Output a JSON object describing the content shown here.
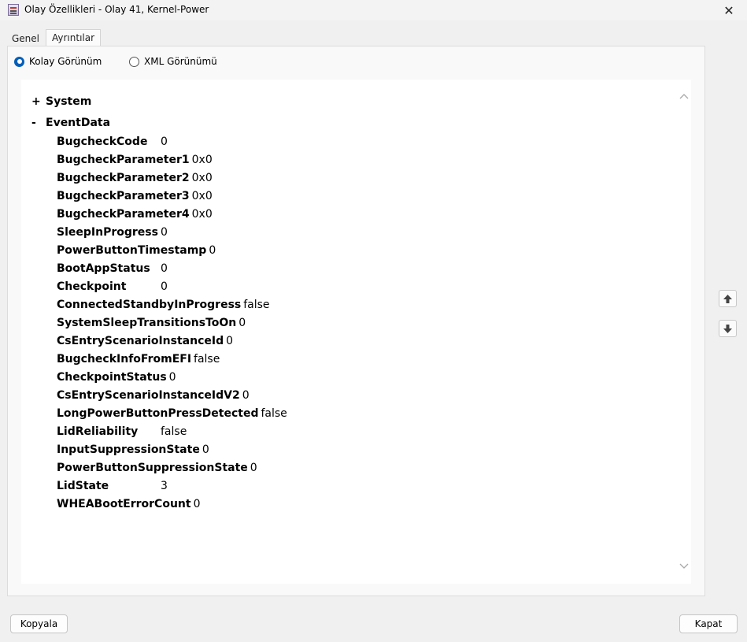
{
  "window": {
    "title": "Olay Özellikleri - Olay 41, Kernel-Power",
    "close_glyph": "✕"
  },
  "tabs": [
    {
      "label": "Genel"
    },
    {
      "label": "Ayrıntılar"
    }
  ],
  "view_options": {
    "easy": "Kolay Görünüm",
    "xml": "XML Görünümü",
    "selected": "Kolay Görünüm"
  },
  "tree": {
    "system": {
      "toggle": "+",
      "label": "System"
    },
    "eventdata": {
      "toggle": "-",
      "label": "EventData"
    },
    "rows": [
      {
        "name": "BugcheckCode",
        "value": "0"
      },
      {
        "name": "BugcheckParameter1",
        "value": "0x0"
      },
      {
        "name": "BugcheckParameter2",
        "value": "0x0"
      },
      {
        "name": "BugcheckParameter3",
        "value": "0x0"
      },
      {
        "name": "BugcheckParameter4",
        "value": "0x0"
      },
      {
        "name": "SleepInProgress",
        "value": "0"
      },
      {
        "name": "PowerButtonTimestamp",
        "value": "0"
      },
      {
        "name": "BootAppStatus",
        "value": "0"
      },
      {
        "name": "Checkpoint",
        "value": "0"
      },
      {
        "name": "ConnectedStandbyInProgress",
        "value": "false"
      },
      {
        "name": "SystemSleepTransitionsToOn",
        "value": "0"
      },
      {
        "name": "CsEntryScenarioInstanceId",
        "value": "0"
      },
      {
        "name": "BugcheckInfoFromEFI",
        "value": "false"
      },
      {
        "name": "CheckpointStatus",
        "value": "0"
      },
      {
        "name": "CsEntryScenarioInstanceIdV2",
        "value": "0"
      },
      {
        "name": "LongPowerButtonPressDetected",
        "value": "false"
      },
      {
        "name": "LidReliability",
        "value": "false"
      },
      {
        "name": "InputSuppressionState",
        "value": "0"
      },
      {
        "name": "PowerButtonSuppressionState",
        "value": "0"
      },
      {
        "name": "LidState",
        "value": "3"
      },
      {
        "name": "WHEABootErrorCount",
        "value": "0"
      }
    ]
  },
  "buttons": {
    "copy": "Kopyala",
    "close": "Kapat"
  },
  "colors": {
    "accent": "#005fb8",
    "window_bg": "#f0f0f0"
  }
}
